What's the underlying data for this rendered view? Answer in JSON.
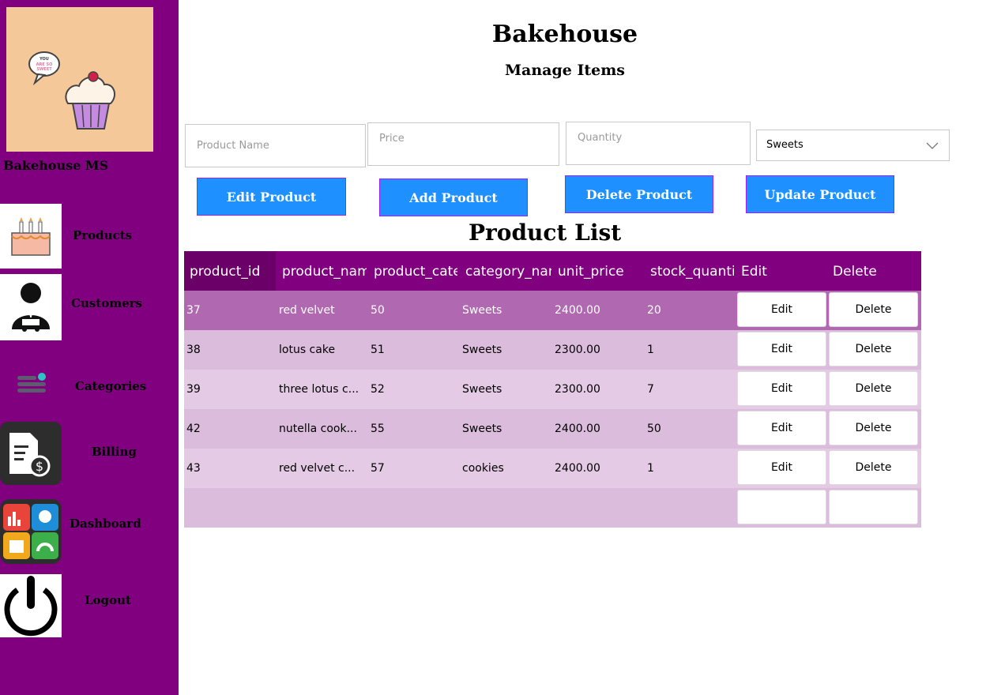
{
  "app": {
    "title": "Bakehouse",
    "subtitle": "Manage Items"
  },
  "sidebar": {
    "brand": "Bakehouse MS",
    "logo": {
      "speech_text": [
        "YOU",
        "ARE SO",
        "SWEET"
      ],
      "background": "#f5c89a"
    },
    "items": [
      {
        "label": "Products",
        "icon": "cake-icon"
      },
      {
        "label": "Customers",
        "icon": "customer-icon"
      },
      {
        "label": "Categories",
        "icon": "menu-lines-icon"
      },
      {
        "label": "Billing",
        "icon": "invoice-icon"
      },
      {
        "label": "Dashboard",
        "icon": "dashboard-icon"
      },
      {
        "label": "Logout",
        "icon": "power-icon"
      }
    ]
  },
  "form": {
    "product_name_placeholder": "Product Name",
    "price_placeholder": "Price",
    "quantity_placeholder": "Quantity",
    "category_selected": "Sweets"
  },
  "buttons": {
    "edit": "Edit Product",
    "add": "Add Product",
    "delete": "Delete Product",
    "update": "Update Product"
  },
  "list": {
    "title": "Product List",
    "columns": [
      "product_id",
      "product_name",
      "product_category",
      "category_name",
      "unit_price",
      "stock_quantity",
      "Edit",
      "Delete"
    ],
    "rows": [
      {
        "product_id": "37",
        "product_name": "red velvet",
        "product_category": "50",
        "category_name": "Sweets",
        "unit_price": "2400.00",
        "stock_quantity": "20",
        "edit": "Edit",
        "delete": "Delete"
      },
      {
        "product_id": "38",
        "product_name": "lotus cake",
        "product_category": "51",
        "category_name": "Sweets",
        "unit_price": "2300.00",
        "stock_quantity": "1",
        "edit": "Edit",
        "delete": "Delete"
      },
      {
        "product_id": "39",
        "product_name": "three lotus c...",
        "product_category": "52",
        "category_name": "Sweets",
        "unit_price": "2300.00",
        "stock_quantity": "7",
        "edit": "Edit",
        "delete": "Delete"
      },
      {
        "product_id": "42",
        "product_name": "nutella cook...",
        "product_category": "55",
        "category_name": "Sweets",
        "unit_price": "2400.00",
        "stock_quantity": "50",
        "edit": "Edit",
        "delete": "Delete"
      },
      {
        "product_id": "43",
        "product_name": "red velvet c...",
        "product_category": "57",
        "category_name": "cookies",
        "unit_price": "2400.00",
        "stock_quantity": "1",
        "edit": "Edit",
        "delete": "Delete"
      }
    ]
  },
  "colors": {
    "sidebar": "#800080",
    "button": "#1e90ff",
    "header": "#800080",
    "selected_row": "#b068b0",
    "row": "#dcbcdc",
    "row_alt": "#e4cae4"
  }
}
